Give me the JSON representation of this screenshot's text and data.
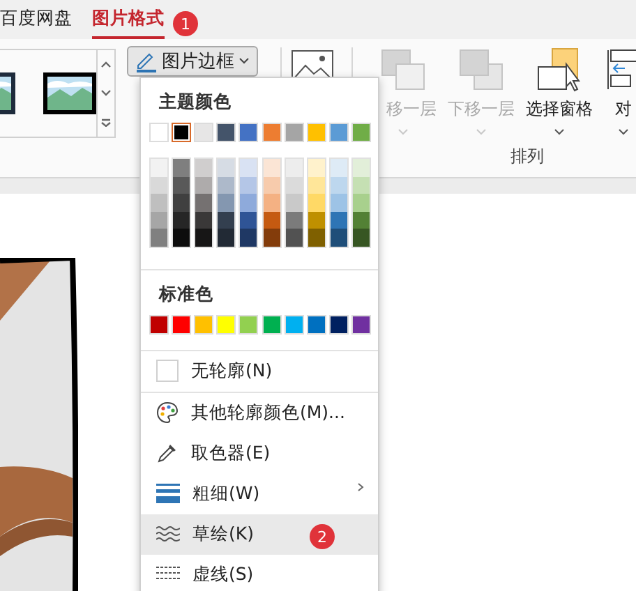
{
  "tabs": [
    {
      "label": "百度网盘",
      "selected": false
    },
    {
      "label": "图片格式",
      "selected": true
    }
  ],
  "ribbon": {
    "border_button": {
      "label": "图片边框",
      "pressed": true
    },
    "arrange_group": {
      "label": "排列",
      "buttons": [
        {
          "kind": "forward",
          "label": "移一层",
          "disabled": true
        },
        {
          "kind": "backward",
          "label": "下移一层",
          "disabled": true
        },
        {
          "kind": "pane",
          "label": "选择窗格",
          "disabled": false
        },
        {
          "kind": "align",
          "label": "对",
          "disabled": false
        }
      ]
    }
  },
  "menu": {
    "theme_header": "主题颜色",
    "theme_colors": [
      {
        "color": "#ffffff",
        "selected": false,
        "shades": [
          {
            "color": "#f2f2f2"
          },
          {
            "color": "#d9d9d9"
          },
          {
            "color": "#bfbfbf"
          },
          {
            "color": "#a6a6a6"
          },
          {
            "color": "#808080"
          }
        ]
      },
      {
        "color": "#000000",
        "selected": true,
        "shades": [
          {
            "color": "#7f7f7f"
          },
          {
            "color": "#595959"
          },
          {
            "color": "#404040"
          },
          {
            "color": "#262626"
          },
          {
            "color": "#0d0d0d"
          }
        ]
      },
      {
        "color": "#e7e6e6",
        "selected": false,
        "shades": [
          {
            "color": "#d0cece"
          },
          {
            "color": "#aeabab"
          },
          {
            "color": "#757171"
          },
          {
            "color": "#3a3838"
          },
          {
            "color": "#171616"
          }
        ]
      },
      {
        "color": "#44546a",
        "selected": false,
        "shades": [
          {
            "color": "#d6dce4"
          },
          {
            "color": "#adb9ca"
          },
          {
            "color": "#8497b0"
          },
          {
            "color": "#333f4f"
          },
          {
            "color": "#222a35"
          }
        ]
      },
      {
        "color": "#4472c4",
        "selected": false,
        "shades": [
          {
            "color": "#d9e2f3"
          },
          {
            "color": "#b4c6e7"
          },
          {
            "color": "#8eaadb"
          },
          {
            "color": "#2f5496"
          },
          {
            "color": "#1f3864"
          }
        ]
      },
      {
        "color": "#ed7d31",
        "selected": false,
        "shades": [
          {
            "color": "#fbe5d5"
          },
          {
            "color": "#f7cbac"
          },
          {
            "color": "#f4b183"
          },
          {
            "color": "#c55a11"
          },
          {
            "color": "#833c0b"
          }
        ]
      },
      {
        "color": "#a5a5a5",
        "selected": false,
        "shades": [
          {
            "color": "#ededed"
          },
          {
            "color": "#dbdbdb"
          },
          {
            "color": "#c9c9c9"
          },
          {
            "color": "#7b7b7b"
          },
          {
            "color": "#525252"
          }
        ]
      },
      {
        "color": "#ffc000",
        "selected": false,
        "shades": [
          {
            "color": "#fff2cc"
          },
          {
            "color": "#ffe699"
          },
          {
            "color": "#ffd966"
          },
          {
            "color": "#bf9000"
          },
          {
            "color": "#7f6000"
          }
        ]
      },
      {
        "color": "#5b9bd5",
        "selected": false,
        "shades": [
          {
            "color": "#deebf6"
          },
          {
            "color": "#bdd7ee"
          },
          {
            "color": "#9dc3e6"
          },
          {
            "color": "#2e75b5"
          },
          {
            "color": "#1f4e79"
          }
        ]
      },
      {
        "color": "#70ad47",
        "selected": false,
        "shades": [
          {
            "color": "#e2efd9"
          },
          {
            "color": "#c5e0b3"
          },
          {
            "color": "#a8d08d"
          },
          {
            "color": "#538135"
          },
          {
            "color": "#375623"
          }
        ]
      }
    ],
    "standard_header": "标准色",
    "standard_colors": [
      {
        "color": "#c00000"
      },
      {
        "color": "#ff0000"
      },
      {
        "color": "#ffc000"
      },
      {
        "color": "#ffff00"
      },
      {
        "color": "#92d050"
      },
      {
        "color": "#00b050"
      },
      {
        "color": "#00b0f0"
      },
      {
        "color": "#0070c0"
      },
      {
        "color": "#002060"
      },
      {
        "color": "#7030a0"
      }
    ],
    "items": [
      {
        "kind": "no-outline",
        "label": "无轮廓(N)",
        "highlighted": false,
        "submenu": false
      },
      {
        "kind": "more-colors",
        "label": "其他轮廓颜色(M)...",
        "highlighted": false,
        "submenu": false
      },
      {
        "kind": "eyedropper",
        "label": "取色器(E)",
        "highlighted": false,
        "submenu": false
      },
      {
        "kind": "weight",
        "label": "粗细(W)",
        "highlighted": false,
        "submenu": true
      },
      {
        "kind": "sketch",
        "label": "草绘(K)",
        "highlighted": true,
        "submenu": false
      },
      {
        "kind": "dash",
        "label": "虚线(S)",
        "highlighted": false,
        "submenu": false
      }
    ]
  },
  "step_markers": [
    {
      "label": "1"
    },
    {
      "label": "2"
    }
  ]
}
